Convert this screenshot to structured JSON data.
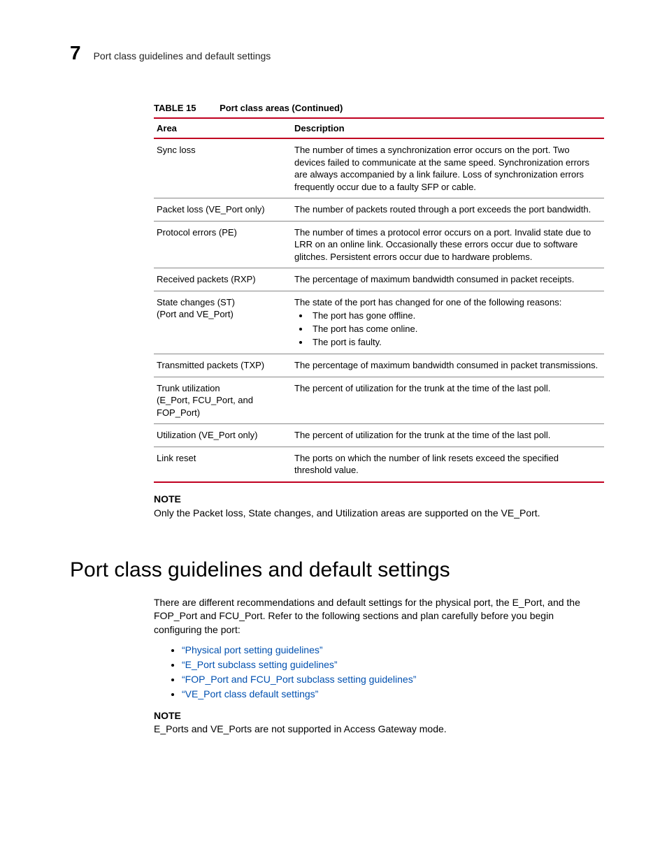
{
  "header": {
    "chapter_number": "7",
    "running_head": "Port class guidelines and default settings"
  },
  "table": {
    "label": "TABLE 15",
    "title": "Port class areas  (Continued)",
    "col_area": "Area",
    "col_desc": "Description",
    "rows": [
      {
        "area": "Sync loss",
        "desc": "The number of times a synchronization error occurs on the port. Two devices failed to communicate at the same speed. Synchronization errors are always accompanied by a link failure. Loss of synchronization errors frequently occur due to a faulty SFP or cable."
      },
      {
        "area": "Packet loss (VE_Port only)",
        "desc": "The number of packets routed through a port exceeds the port bandwidth."
      },
      {
        "area": "Protocol errors (PE)",
        "desc": "The number of times a protocol error occurs on a port. Invalid state due to LRR on an online link. Occasionally these errors occur due to software glitches. Persistent errors occur due to hardware problems."
      },
      {
        "area": "Received packets (RXP)",
        "desc": "The percentage of maximum bandwidth consumed in packet receipts."
      },
      {
        "area_line1": "State changes (ST)",
        "area_line2": "(Port and VE_Port)",
        "desc_intro": "The state of the port has changed for one of the following reasons:",
        "bullets": [
          "The port has gone offline.",
          "The port has come online.",
          "The port is faulty."
        ]
      },
      {
        "area": "Transmitted packets (TXP)",
        "desc": "The percentage of maximum bandwidth consumed in packet transmissions."
      },
      {
        "area_line1": "Trunk utilization",
        "area_line2": "(E_Port, FCU_Port, and FOP_Port)",
        "desc": "The percent of utilization for the trunk at the time of the last poll."
      },
      {
        "area": "Utilization (VE_Port only)",
        "desc": "The percent of utilization for the trunk at the time of the last poll."
      },
      {
        "area": "Link reset",
        "desc": "The ports on which the number of link resets exceed the specified threshold value."
      }
    ]
  },
  "note1": {
    "label": "NOTE",
    "text": "Only the Packet loss, State changes, and Utilization areas are supported on the VE_Port."
  },
  "section": {
    "title": "Port class guidelines and default settings",
    "intro": "There are different recommendations and default settings for the physical port, the E_Port, and the FOP_Port and FCU_Port. Refer to the following sections and plan carefully before you begin configuring the port:",
    "links": [
      "“Physical port setting guidelines”",
      "“E_Port subclass setting guidelines”",
      "“FOP_Port and FCU_Port subclass setting guidelines”",
      "“VE_Port class default settings”"
    ]
  },
  "note2": {
    "label": "NOTE",
    "text": "E_Ports and VE_Ports are not supported in Access Gateway mode."
  }
}
